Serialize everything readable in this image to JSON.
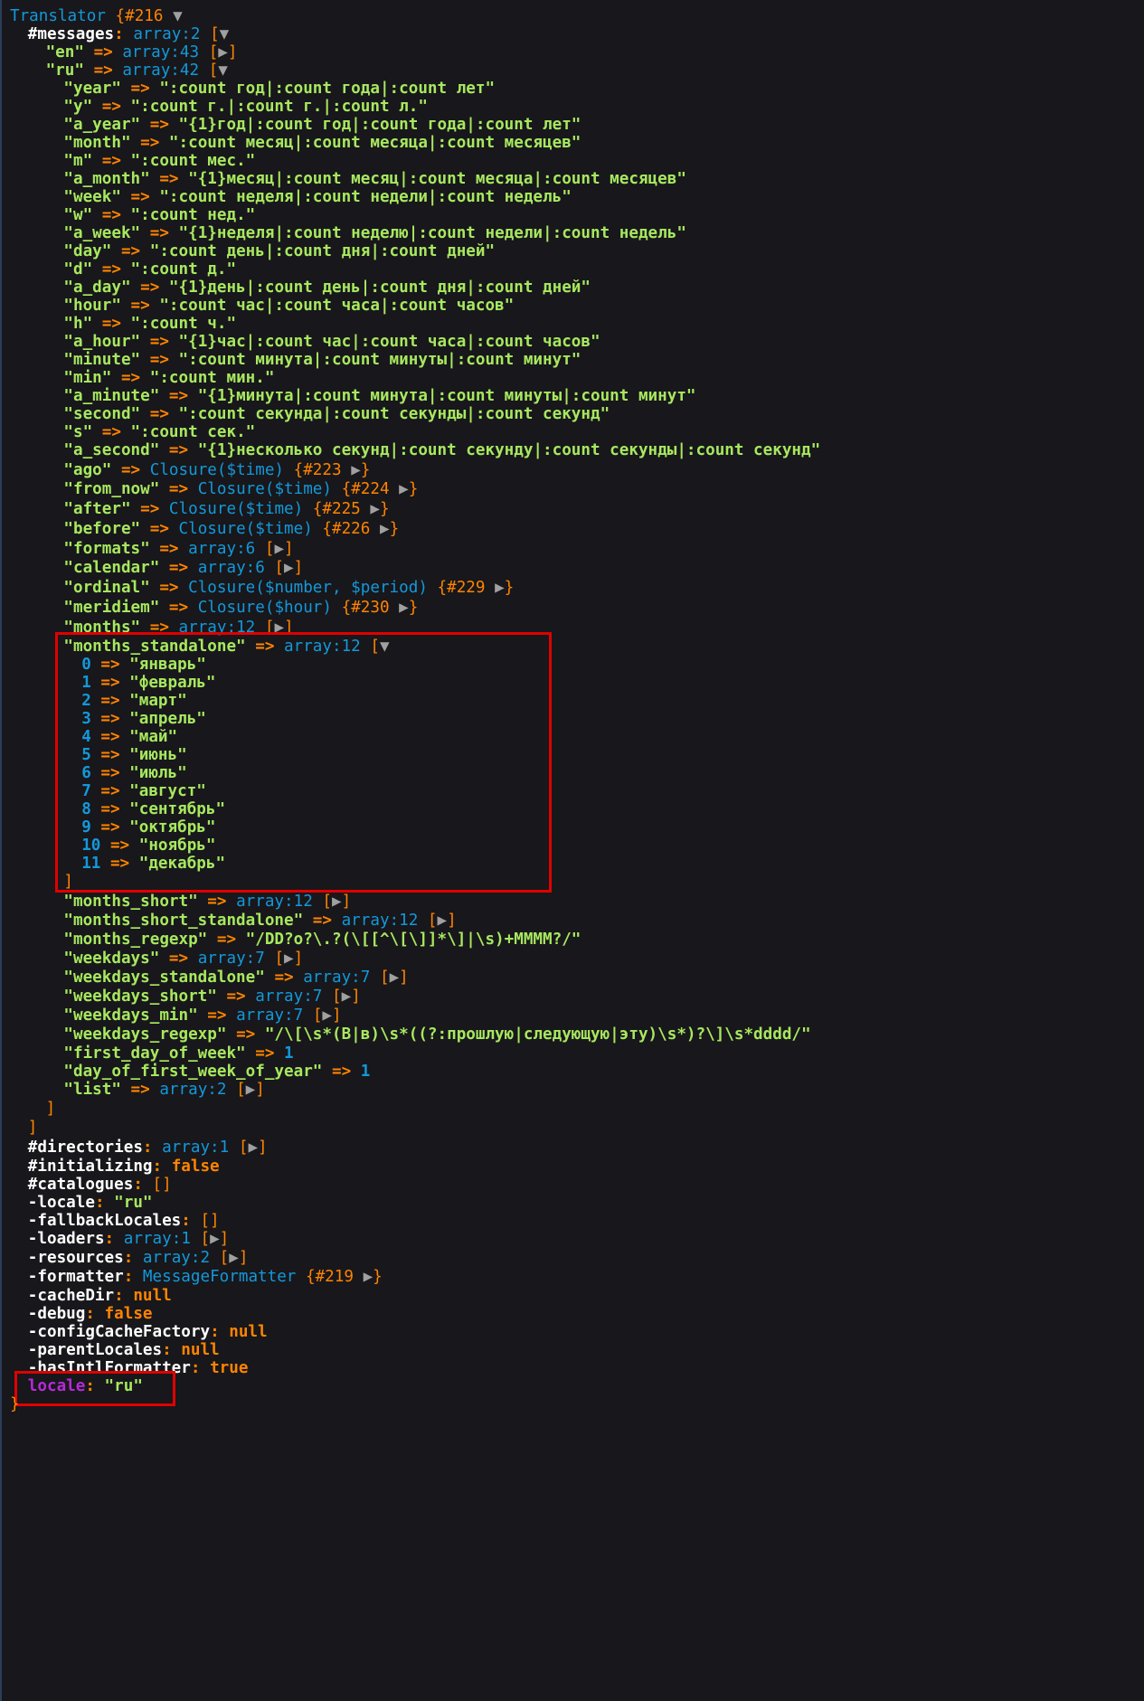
{
  "colors": {
    "background": "#18171b",
    "string": "#a7e85f",
    "type": "#1299da",
    "bracket": "#ff8400",
    "property": "#ffffff",
    "highlight_box": "#e00000",
    "public_prop": "#b729d9"
  },
  "icons": [
    "toggle-expanded-icon",
    "toggle-collapsed-icon"
  ],
  "header": {
    "class": "Translator",
    "id": "#216"
  },
  "messages": {
    "name": "#messages",
    "type": "array:2",
    "en": {
      "key": "\"en\"",
      "type": "array:43"
    },
    "ru": {
      "key": "\"ru\"",
      "type": "array:42",
      "entries": [
        {
          "key": "\"year\"",
          "value": "\":count год|:count года|:count лет\""
        },
        {
          "key": "\"y\"",
          "value": "\":count г.|:count г.|:count л.\""
        },
        {
          "key": "\"a_year\"",
          "value": "\"{1}год|:count год|:count года|:count лет\""
        },
        {
          "key": "\"month\"",
          "value": "\":count месяц|:count месяца|:count месяцев\""
        },
        {
          "key": "\"m\"",
          "value": "\":count мес.\""
        },
        {
          "key": "\"a_month\"",
          "value": "\"{1}месяц|:count месяц|:count месяца|:count месяцев\""
        },
        {
          "key": "\"week\"",
          "value": "\":count неделя|:count недели|:count недель\""
        },
        {
          "key": "\"w\"",
          "value": "\":count нед.\""
        },
        {
          "key": "\"a_week\"",
          "value": "\"{1}неделя|:count неделю|:count недели|:count недель\""
        },
        {
          "key": "\"day\"",
          "value": "\":count день|:count дня|:count дней\""
        },
        {
          "key": "\"d\"",
          "value": "\":count д.\""
        },
        {
          "key": "\"a_day\"",
          "value": "\"{1}день|:count день|:count дня|:count дней\""
        },
        {
          "key": "\"hour\"",
          "value": "\":count час|:count часа|:count часов\""
        },
        {
          "key": "\"h\"",
          "value": "\":count ч.\""
        },
        {
          "key": "\"a_hour\"",
          "value": "\"{1}час|:count час|:count часа|:count часов\""
        },
        {
          "key": "\"minute\"",
          "value": "\":count минута|:count минуты|:count минут\""
        },
        {
          "key": "\"min\"",
          "value": "\":count мин.\""
        },
        {
          "key": "\"a_minute\"",
          "value": "\"{1}минута|:count минута|:count минуты|:count минут\""
        },
        {
          "key": "\"second\"",
          "value": "\":count секунда|:count секунды|:count секунд\""
        },
        {
          "key": "\"s\"",
          "value": "\":count сек.\""
        },
        {
          "key": "\"a_second\"",
          "value": "\"{1}несколько секунд|:count секунду|:count секунды|:count секунд\""
        }
      ],
      "closures": [
        {
          "key": "\"ago\"",
          "sig": "Closure($time)",
          "id": "#223"
        },
        {
          "key": "\"from_now\"",
          "sig": "Closure($time)",
          "id": "#224"
        },
        {
          "key": "\"after\"",
          "sig": "Closure($time)",
          "id": "#225"
        },
        {
          "key": "\"before\"",
          "sig": "Closure($time)",
          "id": "#226"
        }
      ],
      "formats": {
        "key": "\"formats\"",
        "type": "array:6"
      },
      "calendar": {
        "key": "\"calendar\"",
        "type": "array:6"
      },
      "ordinal": {
        "key": "\"ordinal\"",
        "sig": "Closure($number, $period)",
        "id": "#229"
      },
      "meridiem": {
        "key": "\"meridiem\"",
        "sig": "Closure($hour)",
        "id": "#230"
      },
      "months": {
        "key": "\"months\"",
        "type": "array:12"
      },
      "months_standalone": {
        "key": "\"months_standalone\"",
        "type": "array:12",
        "items": [
          {
            "i": "0",
            "v": "\"январь\""
          },
          {
            "i": "1",
            "v": "\"февраль\""
          },
          {
            "i": "2",
            "v": "\"март\""
          },
          {
            "i": "3",
            "v": "\"апрель\""
          },
          {
            "i": "4",
            "v": "\"май\""
          },
          {
            "i": "5",
            "v": "\"июнь\""
          },
          {
            "i": "6",
            "v": "\"июль\""
          },
          {
            "i": "7",
            "v": "\"август\""
          },
          {
            "i": "8",
            "v": "\"сентябрь\""
          },
          {
            "i": "9",
            "v": "\"октябрь\""
          },
          {
            "i": "10",
            "v": "\"ноябрь\""
          },
          {
            "i": "11",
            "v": "\"декабрь\""
          }
        ]
      },
      "tail_arrays": [
        {
          "key": "\"months_short\"",
          "type": "array:12"
        },
        {
          "key": "\"months_short_standalone\"",
          "type": "array:12"
        }
      ],
      "months_regexp": {
        "key": "\"months_regexp\"",
        "value": "\"/DD?o?\\.?(\\[[^\\[\\]]*\\]|\\s)+MMMM?/\""
      },
      "weekday_arrays": [
        {
          "key": "\"weekdays\"",
          "type": "array:7"
        },
        {
          "key": "\"weekdays_standalone\"",
          "type": "array:7"
        },
        {
          "key": "\"weekdays_short\"",
          "type": "array:7"
        },
        {
          "key": "\"weekdays_min\"",
          "type": "array:7"
        }
      ],
      "weekdays_regexp": {
        "key": "\"weekdays_regexp\"",
        "value": "\"/\\[\\s*(В|в)\\s*((?:прошлую|следующую|эту)\\s*)?\\]\\s*dddd/\""
      },
      "first_day_of_week": {
        "key": "\"first_day_of_week\"",
        "value": "1"
      },
      "day_of_first_week_of_year": {
        "key": "\"day_of_first_week_of_year\"",
        "value": "1"
      },
      "list": {
        "key": "\"list\"",
        "type": "array:2"
      }
    }
  },
  "props": {
    "directories": {
      "name": "#directories",
      "type": "array:1"
    },
    "initializing": {
      "name": "#initializing",
      "value": "false"
    },
    "catalogues": {
      "name": "#catalogues",
      "value": "[]"
    },
    "locale": {
      "name": "-locale",
      "value": "\"ru\""
    },
    "fallbackLocales": {
      "name": "-fallbackLocales",
      "value": "[]"
    },
    "loaders": {
      "name": "-loaders",
      "type": "array:1"
    },
    "resources": {
      "name": "-resources",
      "type": "array:2"
    },
    "formatter": {
      "name": "-formatter",
      "sig": "MessageFormatter",
      "id": "#219"
    },
    "cacheDir": {
      "name": "-cacheDir",
      "value": "null"
    },
    "debug": {
      "name": "-debug",
      "value": "false"
    },
    "configCacheFactory": {
      "name": "-configCacheFactory",
      "value": "null"
    },
    "parentLocales": {
      "name": "-parentLocales",
      "value": "null"
    },
    "hasIntlFormatter": {
      "name": "-hasIntlFormatter",
      "value": "true"
    },
    "public_locale": {
      "name": "locale",
      "value": "\"ru\""
    }
  },
  "symbols": {
    "arrow": "=>",
    "colon": ":",
    "open_bracket": "[",
    "close_bracket": "]",
    "open_brace": "{",
    "close_brace": "}",
    "expanded": "▼",
    "collapsed": "▶"
  }
}
